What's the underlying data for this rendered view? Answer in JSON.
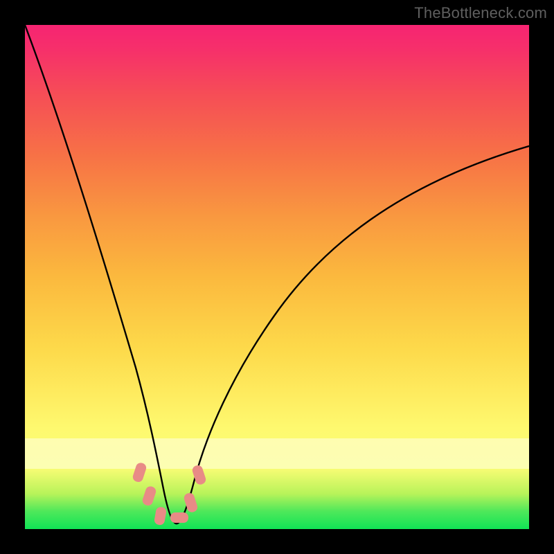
{
  "watermark": "TheBottleneck.com",
  "chart_data": {
    "type": "line",
    "title": "",
    "xlabel": "",
    "ylabel": "",
    "xlim": [
      0,
      100
    ],
    "ylim": [
      0,
      100
    ],
    "grid": false,
    "legend": false,
    "background_gradient": {
      "stops": [
        {
          "pos": 0,
          "color": "#10e456"
        },
        {
          "pos": 3.5,
          "color": "#4ee85a"
        },
        {
          "pos": 7,
          "color": "#b8f35a"
        },
        {
          "pos": 12,
          "color": "#f8fc74"
        },
        {
          "pos": 20,
          "color": "#fef96f"
        },
        {
          "pos": 36,
          "color": "#fdd94a"
        },
        {
          "pos": 50,
          "color": "#fbb93e"
        },
        {
          "pos": 62,
          "color": "#f99840"
        },
        {
          "pos": 74,
          "color": "#f77246"
        },
        {
          "pos": 86,
          "color": "#f64e56"
        },
        {
          "pos": 95,
          "color": "#f6306a"
        },
        {
          "pos": 100,
          "color": "#f62472"
        }
      ],
      "pale_band_y": [
        12,
        18
      ]
    },
    "series": [
      {
        "name": "bottleneck-curve",
        "color": "#000000",
        "x": [
          0,
          5,
          10,
          15,
          19,
          22,
          24,
          26,
          28,
          30,
          32,
          36,
          42,
          50,
          60,
          72,
          86,
          100
        ],
        "y": [
          100,
          83,
          66,
          48,
          32,
          20,
          11,
          5,
          2,
          1,
          1,
          5,
          12,
          23,
          36,
          50,
          64,
          76
        ]
      }
    ],
    "markers": {
      "name": "highlight-dots",
      "color": "#e88b86",
      "shape": "rounded-rect",
      "points": [
        {
          "x": 22.5,
          "y": 11.0
        },
        {
          "x": 24.2,
          "y": 6.0
        },
        {
          "x": 26.5,
          "y": 2.2
        },
        {
          "x": 30.0,
          "y": 1.5
        },
        {
          "x": 32.5,
          "y": 5.0
        },
        {
          "x": 34.0,
          "y": 10.5
        }
      ]
    }
  }
}
